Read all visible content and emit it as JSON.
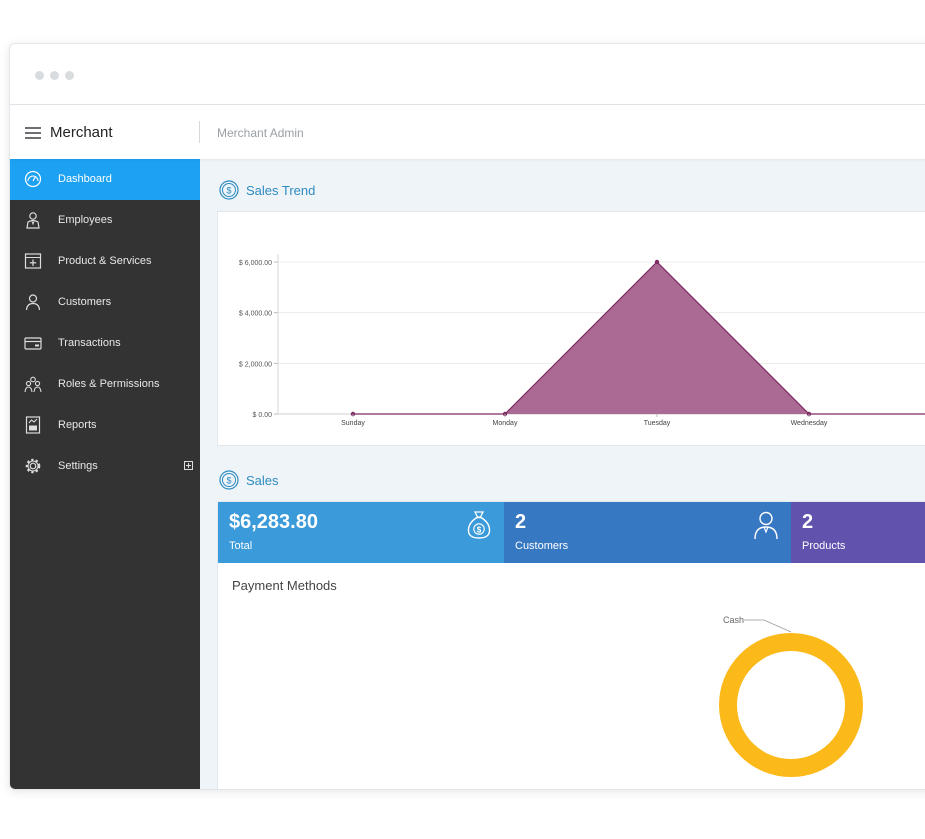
{
  "brand": "Merchant",
  "breadcrumb": "Merchant Admin",
  "sidebar": {
    "items": [
      {
        "label": "Dashboard",
        "icon": "dashboard-icon",
        "active": true
      },
      {
        "label": "Employees",
        "icon": "employee-icon"
      },
      {
        "label": "Product & Services",
        "icon": "product-box-icon"
      },
      {
        "label": "Customers",
        "icon": "customer-icon"
      },
      {
        "label": "Transactions",
        "icon": "card-icon"
      },
      {
        "label": "Roles & Permissions",
        "icon": "group-icon"
      },
      {
        "label": "Reports",
        "icon": "report-icon"
      },
      {
        "label": "Settings",
        "icon": "gear-icon",
        "expand_icon": "plus-square-icon"
      }
    ]
  },
  "sales_trend": {
    "title": "Sales Trend",
    "icon": "dollar-circle-icon"
  },
  "sales": {
    "title": "Sales",
    "icon": "dollar-circle-icon",
    "tiles": [
      {
        "value": "$6,283.80",
        "label": "Total",
        "icon": "money-bag-icon",
        "color": "#3b9ad9"
      },
      {
        "value": "2",
        "label": "Customers",
        "icon": "customer-icon",
        "color": "#3778c2"
      },
      {
        "value": "2",
        "label": "Products",
        "color": "#6152ad"
      }
    ]
  },
  "payment_methods": {
    "title": "Payment Methods",
    "slice_label": "Cash",
    "slice_color": "#fbb91a",
    "share": 1.0
  },
  "chart_data": {
    "type": "area",
    "categories": [
      "Sunday",
      "Monday",
      "Tuesday",
      "Wednesday"
    ],
    "values": [
      0,
      0,
      6000,
      0
    ],
    "ylim": [
      0,
      6000
    ],
    "yticks": [
      0,
      2000,
      4000,
      6000
    ],
    "ytick_labels": [
      "$ 0.00",
      "$ 2,000.00",
      "$ 4,000.00",
      "$ 6,000.00"
    ],
    "fill_color": "#ab6a93",
    "line_color": "#7e2a63",
    "grid": true
  }
}
